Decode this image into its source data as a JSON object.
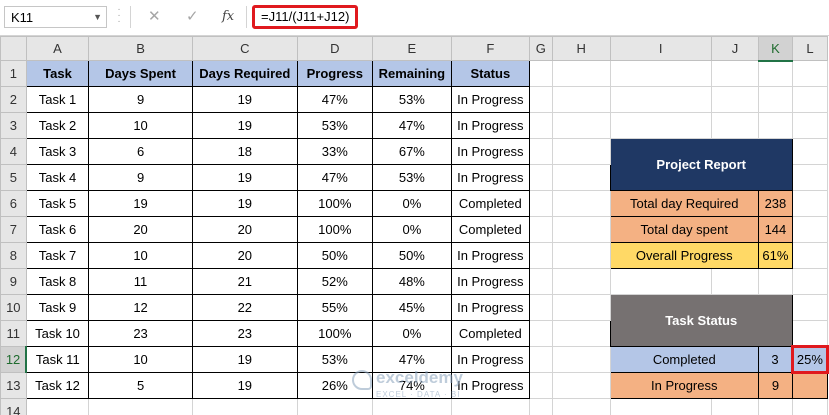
{
  "formula_bar": {
    "name_box": "K11",
    "cancel_icon": "✕",
    "enter_icon": "✓",
    "fx_label": "fx",
    "formula": "=J11/(J11+J12)"
  },
  "columns": [
    "A",
    "B",
    "C",
    "D",
    "E",
    "F",
    "G",
    "H",
    "I",
    "J",
    "K",
    "L"
  ],
  "rows": [
    "1",
    "2",
    "3",
    "4",
    "5",
    "6",
    "7",
    "8",
    "9",
    "10",
    "11",
    "12",
    "13",
    "14"
  ],
  "task_table": {
    "headers": [
      "Task",
      "Days Spent",
      "Days Required",
      "Progress",
      "Remaining",
      "Status"
    ],
    "rows": [
      [
        "Task 1",
        "9",
        "19",
        "47%",
        "53%",
        "In Progress"
      ],
      [
        "Task 2",
        "10",
        "19",
        "53%",
        "47%",
        "In Progress"
      ],
      [
        "Task 3",
        "6",
        "18",
        "33%",
        "67%",
        "In Progress"
      ],
      [
        "Task 4",
        "9",
        "19",
        "47%",
        "53%",
        "In Progress"
      ],
      [
        "Task 5",
        "19",
        "19",
        "100%",
        "0%",
        "Completed"
      ],
      [
        "Task 6",
        "20",
        "20",
        "100%",
        "0%",
        "Completed"
      ],
      [
        "Task 7",
        "10",
        "20",
        "50%",
        "50%",
        "In Progress"
      ],
      [
        "Task 8",
        "11",
        "21",
        "52%",
        "48%",
        "In Progress"
      ],
      [
        "Task 9",
        "12",
        "22",
        "55%",
        "45%",
        "In Progress"
      ],
      [
        "Task 10",
        "23",
        "23",
        "100%",
        "0%",
        "Completed"
      ],
      [
        "Task 11",
        "10",
        "19",
        "53%",
        "47%",
        "In Progress"
      ],
      [
        "Task 12",
        "5",
        "19",
        "26%",
        "74%",
        "In Progress"
      ]
    ]
  },
  "project_report": {
    "title": "Project Report",
    "rows": [
      {
        "label": "Total day Required",
        "value": "238"
      },
      {
        "label": "Total day spent",
        "value": "144"
      },
      {
        "label": "Overall Progress",
        "value": "61%"
      }
    ]
  },
  "task_status": {
    "title": "Task Status",
    "rows": [
      {
        "label": "Completed",
        "count": "3",
        "pct": "25%"
      },
      {
        "label": "In Progress",
        "count": "9",
        "pct": ""
      }
    ]
  },
  "watermark": {
    "main": "exceldemy",
    "sub": "EXCEL · DATA · BI"
  },
  "colors": {
    "header_blue": "#b4c6e7",
    "report_title_navy": "#1f3864",
    "orange": "#f4b183",
    "yellow": "#ffd966",
    "status_title_gray": "#767171",
    "highlight_red": "#e0191e"
  }
}
